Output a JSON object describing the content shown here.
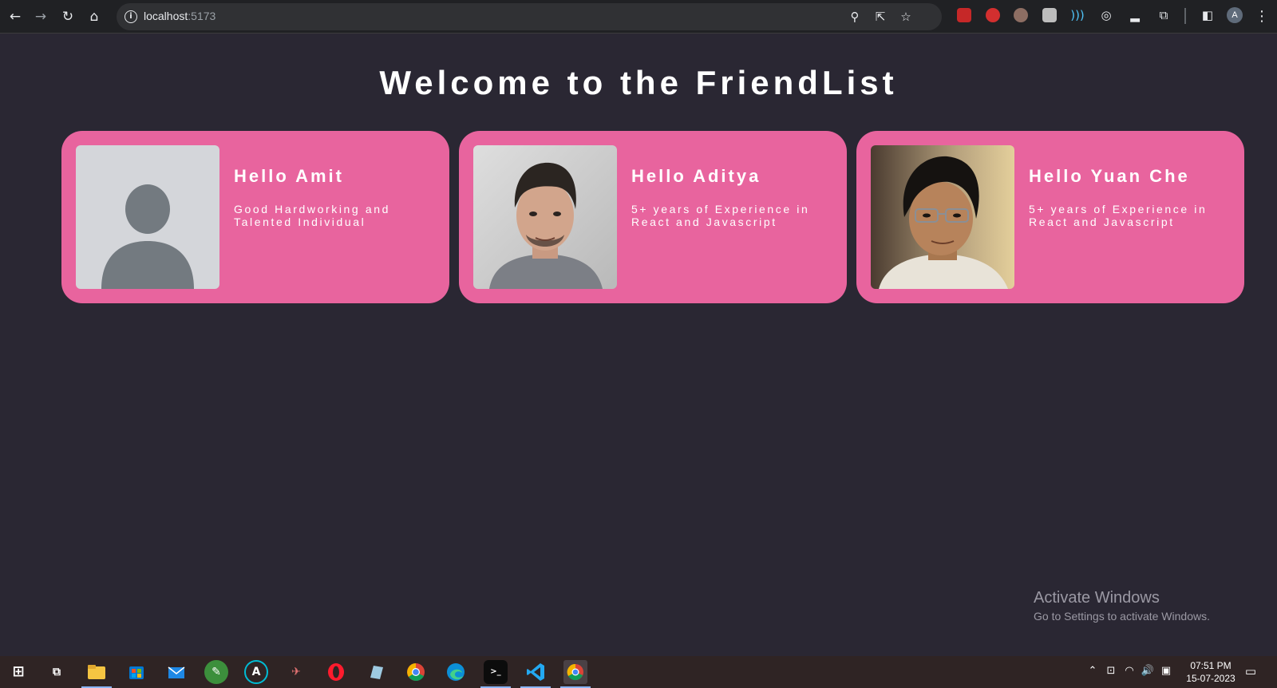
{
  "browser": {
    "url_host": "localhost",
    "url_port": ":5173",
    "profile_initial": "A",
    "icons": [
      "back-arrow-icon",
      "forward-arrow-icon",
      "reload-icon",
      "home-icon",
      "info-icon",
      "zoom-icon",
      "share-icon",
      "star-icon",
      "extensions-puzzle-icon",
      "side-panel-icon",
      "menu-dots-icon"
    ]
  },
  "page": {
    "title": "Welcome to the FriendList",
    "background_color": "#2a2733",
    "card_color": "#e8649e"
  },
  "cards": [
    {
      "name": "Hello Amit",
      "description": "Good Hardworking and Talented Individual",
      "photo": "default-avatar-placeholder"
    },
    {
      "name": "Hello Aditya",
      "description": "5+ years of Experience in React and Javascript",
      "photo": "man-portrait-photo"
    },
    {
      "name": "Hello Yuan Che",
      "description": "5+ years of Experience in React and Javascript",
      "photo": "man-with-glasses-portrait-photo"
    }
  ],
  "watermark": {
    "title": "Activate Windows",
    "subtitle": "Go to Settings to activate Windows."
  },
  "taskbar": {
    "time": "07:51 PM",
    "date": "15-07-2023",
    "apps": [
      "windows-start-icon",
      "task-view-icon",
      "file-explorer-icon",
      "microsoft-store-icon",
      "mail-icon",
      "app-icon",
      "arduino-icon",
      "app-icon",
      "opera-icon",
      "app-icon",
      "chrome-icon",
      "edge-icon",
      "terminal-icon",
      "vscode-icon",
      "chrome-profile-icon"
    ]
  }
}
